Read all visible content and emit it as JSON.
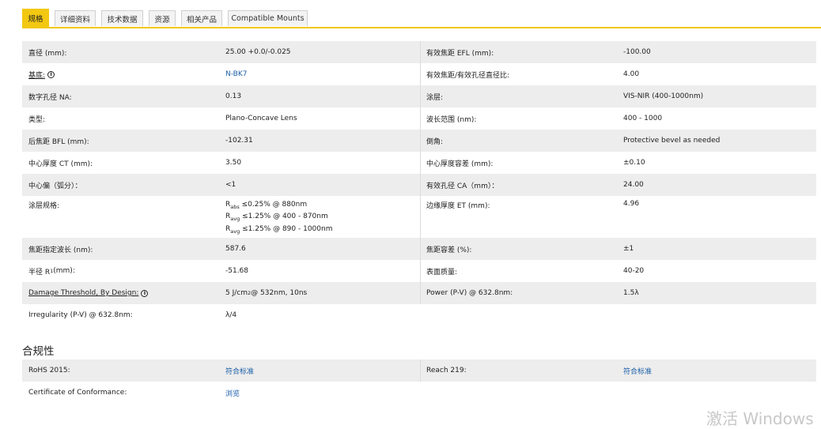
{
  "tabs": [
    {
      "label": "规格",
      "active": true
    },
    {
      "label": "详细资料",
      "active": false
    },
    {
      "label": "技术数据",
      "active": false
    },
    {
      "label": "资源",
      "active": false
    },
    {
      "label": "相关产品",
      "active": false
    },
    {
      "label": "Compatible Mounts",
      "active": false
    }
  ],
  "specs": [
    {
      "l1": "直径 (mm):",
      "v1": "25.00 +0.0/-0.025",
      "l2": "有效焦距 EFL (mm):",
      "v2": "-100.00"
    },
    {
      "l1": "基底:",
      "v1": "N-BK7",
      "l2": "有效焦距/有效孔径直径比:",
      "v2": "4.00"
    },
    {
      "l1": "数字孔径 NA:",
      "v1": "0.13",
      "l2": "涂层:",
      "v2": "VIS-NIR (400-1000nm)"
    },
    {
      "l1": "类型:",
      "v1": "Plano-Concave Lens",
      "l2": "波长范围 (nm):",
      "v2": "400 - 1000"
    },
    {
      "l1": "后焦距 BFL (mm):",
      "v1": "-102.31",
      "l2": "倒角:",
      "v2": "Protective bevel as needed"
    },
    {
      "l1": "中心厚度 CT (mm):",
      "v1": "3.50",
      "l2": "中心厚度容差 (mm):",
      "v2": "±0.10"
    },
    {
      "l1": "中心偏（弧分）：",
      "v1": "<1",
      "l2": "有效孔径 CA（mm）：",
      "v2": "24.00"
    },
    {
      "l1": "涂层规格:",
      "l2": "边缘厚度 ET (mm):",
      "v2": "4.96",
      "coating": [
        {
          "sym": "R",
          "sub": "abs",
          "text": " ≤0.25% @ 880nm"
        },
        {
          "sym": "R",
          "sub": "avg",
          "text": " ≤1.25% @ 400 - 870nm"
        },
        {
          "sym": "R",
          "sub": "avg",
          "text": " ≤1.25% @ 890 - 1000nm"
        }
      ]
    },
    {
      "l1": "焦距指定波长 (nm):",
      "v1": "587.6",
      "l2": "焦距容差 (%):",
      "v2": "±1"
    },
    {
      "l1_pre": "半径 R",
      "l1_sub": "1",
      "l1_post": " (mm):",
      "v1": "-51.68",
      "l2": "表面质量:",
      "v2": "40-20"
    },
    {
      "l1": "Damage Threshold, By Design:",
      "v1_pre": "5 J/cm",
      "v1_sup": "2",
      "v1_post": " @ 532nm, 10ns",
      "l2": "Power (P-V) @ 632.8nm:",
      "v2": "1.5λ"
    },
    {
      "l1": "Irregularity (P-V) @ 632.8nm:",
      "v1": "λ/4"
    }
  ],
  "compliance": {
    "title": "合规性",
    "rows": [
      {
        "l1": "RoHS 2015:",
        "v1": "符合标准",
        "l2": "Reach 219:",
        "v2": "符合标准"
      },
      {
        "l1": "Certificate of Conformance:",
        "v1": "浏览"
      }
    ]
  },
  "info_icon_glyph": "i",
  "watermark": "激活 Windows",
  "colors": {
    "accent": "#f2c811",
    "link": "#1a5fa8",
    "row_shade": "#ededed"
  }
}
